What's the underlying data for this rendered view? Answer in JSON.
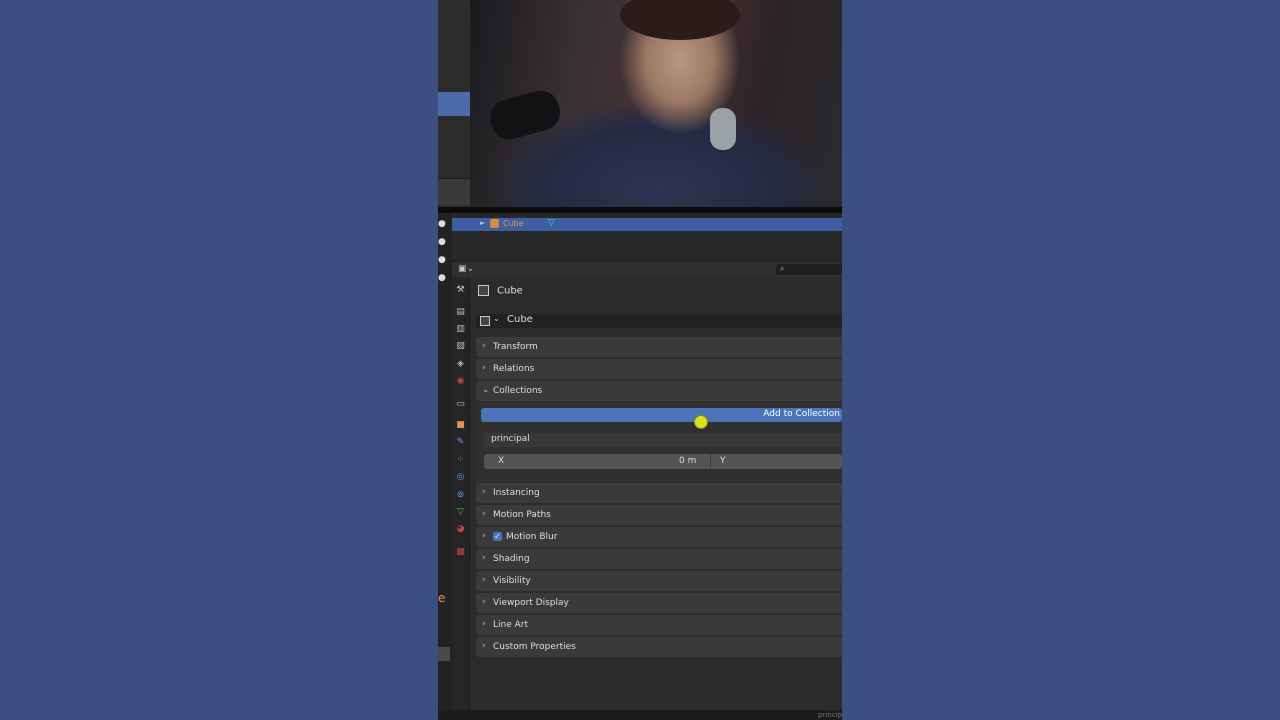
{
  "outliner": {
    "object_name": "Cube"
  },
  "properties": {
    "object_header": "Cube",
    "name_field": "Cube",
    "panels": {
      "transform": "Transform",
      "relations": "Relations",
      "collections": "Collections",
      "instancing": "Instancing",
      "motion_paths": "Motion Paths",
      "motion_blur": "Motion Blur",
      "shading": "Shading",
      "visibility": "Visibility",
      "viewport_display": "Viewport Display",
      "line_art": "Line Art",
      "custom_properties": "Custom Properties"
    },
    "motion_blur_checked": true,
    "collections": {
      "add_button_label": "Add to Collection",
      "collection_name": "principal",
      "offset_x_label": "X",
      "offset_x_value": "0 m",
      "offset_y_label": "Y"
    }
  },
  "status_bar": {
    "text": "princip"
  },
  "icons": {
    "expand": "chevron-right-icon",
    "collapse": "chevron-down-icon",
    "object": "object-cube-icon",
    "mesh": "mesh-triangle-icon",
    "search": "search-icon",
    "checkbox": "checkbox-icon"
  },
  "colors": {
    "accent_blue": "#4d74b8",
    "selection_blue": "#3d5ea0",
    "cursor_highlight": "#d8e020",
    "object_orange": "#e89a4a",
    "background": "#3b4f80"
  }
}
